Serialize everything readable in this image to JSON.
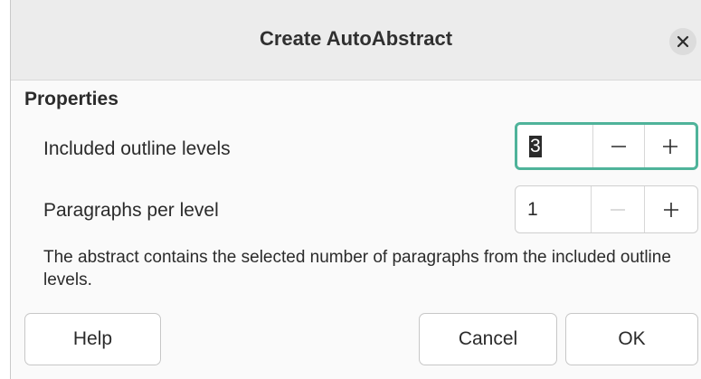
{
  "dialog": {
    "title": "Create AutoAbstract"
  },
  "properties": {
    "heading": "Properties",
    "outline_levels": {
      "label": "Included outline levels",
      "value": "3"
    },
    "paragraphs_per_level": {
      "label": "Paragraphs per level",
      "value": "1"
    },
    "description": "The abstract contains the selected number of paragraphs from the included outline levels."
  },
  "buttons": {
    "help": "Help",
    "cancel": "Cancel",
    "ok": "OK"
  },
  "icons": {
    "close": "close-icon",
    "minus": "minus-icon",
    "plus": "plus-icon"
  },
  "colors": {
    "focus_border": "#4fb39a",
    "titlebar": "#ececec"
  }
}
